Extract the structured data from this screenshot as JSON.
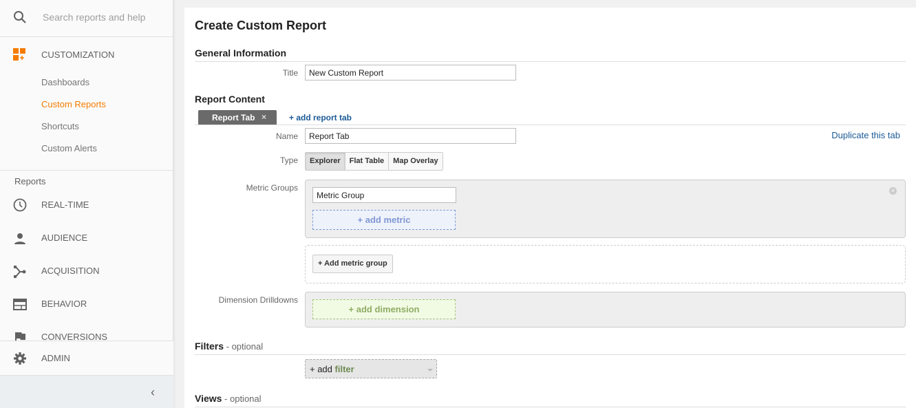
{
  "sidebar": {
    "search_placeholder": "Search reports and help",
    "customization": {
      "label": "CUSTOMIZATION",
      "icon": "customization-icon",
      "items": [
        {
          "label": "Dashboards",
          "active": false
        },
        {
          "label": "Custom Reports",
          "active": true
        },
        {
          "label": "Shortcuts",
          "active": false
        },
        {
          "label": "Custom Alerts",
          "active": false
        }
      ]
    },
    "reports_label": "Reports",
    "reports": [
      {
        "label": "REAL-TIME",
        "icon": "clock-icon"
      },
      {
        "label": "AUDIENCE",
        "icon": "person-icon"
      },
      {
        "label": "ACQUISITION",
        "icon": "acquisition-icon"
      },
      {
        "label": "BEHAVIOR",
        "icon": "behavior-icon"
      },
      {
        "label": "CONVERSIONS",
        "icon": "flag-icon"
      }
    ],
    "admin": {
      "label": "ADMIN",
      "icon": "gear-icon"
    },
    "collapse_icon": "‹",
    "accent_color": "#f57c00"
  },
  "main": {
    "title": "Create Custom Report",
    "general": {
      "heading": "General Information",
      "title_label": "Title",
      "title_value": "New Custom Report"
    },
    "content": {
      "heading": "Report Content",
      "tab_label": "Report Tab",
      "tab_close": "×",
      "add_tab": "+ add report tab",
      "duplicate": "Duplicate this tab",
      "name_label": "Name",
      "name_value": "Report Tab",
      "type_label": "Type",
      "types": [
        "Explorer",
        "Flat Table",
        "Map Overlay"
      ],
      "selected_type": "Explorer",
      "metric_groups_label": "Metric Groups",
      "metric_group_value": "Metric Group",
      "add_metric": "+ add metric",
      "add_metric_group": "+ Add metric group",
      "dimension_label": "Dimension Drilldowns",
      "add_dimension": "+ add dimension"
    },
    "filters": {
      "heading": "Filters",
      "optional": " - optional",
      "add_prefix": "+ add ",
      "add_keyword": "filter"
    },
    "views": {
      "heading": "Views",
      "optional": " - optional"
    }
  }
}
